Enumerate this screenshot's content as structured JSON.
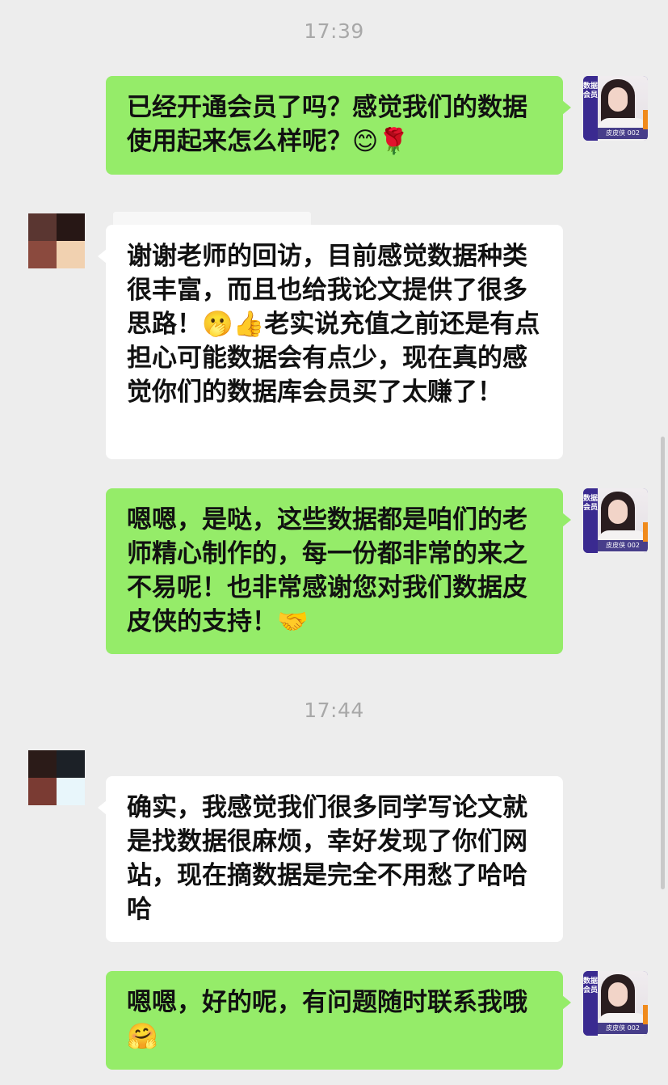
{
  "chat": {
    "timestamps": [
      "17:39",
      "17:44"
    ],
    "messages": [
      {
        "sender": "me",
        "text": "已经开通会员了吗？感觉我们的数据使用起来怎么样呢？",
        "emoji": "😊🌹"
      },
      {
        "sender": "other",
        "text_a": "谢谢老师的回访，目前感觉数据种类很丰富，而且也给我论文提供了很多思路！",
        "emoji": "🫢👍",
        "text_b": "老实说充值之前还是有点担心可能数据会有点少，现在真的感觉你们的数据库会员买了太赚了！"
      },
      {
        "sender": "me",
        "text": "嗯嗯，是哒，这些数据都是咱们的老师精心制作的，每一份都非常的来之不易呢！也非常感谢您对我们数据皮皮侠的支持！",
        "emoji": "🤝"
      },
      {
        "sender": "other",
        "text": "确实，我感觉我们很多同学写论文就是找数据很麻烦，幸好发现了你们网站，现在摘数据是完全不用愁了哈哈哈"
      },
      {
        "sender": "me",
        "text": "嗯嗯，好的呢，有问题随时联系我哦",
        "emoji": "🤗"
      }
    ]
  },
  "avatar_me": {
    "side_label": "数据会员",
    "tag_label": "皮皮侠 002"
  },
  "colors": {
    "background": "#ededed",
    "bubble_me": "#95ec69",
    "bubble_other": "#ffffff",
    "timestamp": "#a8a8a8"
  }
}
